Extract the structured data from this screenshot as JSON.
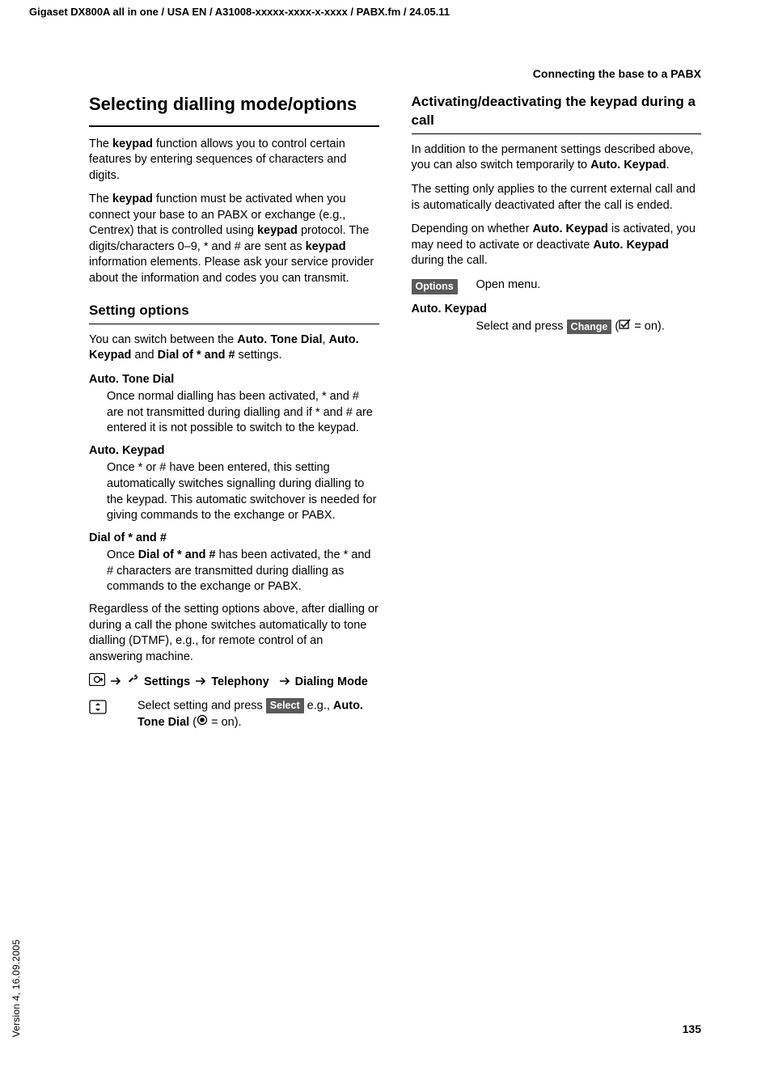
{
  "meta": {
    "header": "Gigaset DX800A all in one / USA EN / A31008-xxxxx-xxxx-x-xxxx / PABX.fm / 24.05.11",
    "section_header": "Connecting the base to a PABX",
    "page_number": "135",
    "version_side": "Version 4, 16.09.2005"
  },
  "left": {
    "h1": "Selecting dialling mode/options",
    "p1_a": "The ",
    "p1_b": "keypad",
    "p1_c": " function allows you to control certain features by entering sequences of characters and digits.",
    "p2_a": "The ",
    "p2_b": "keypad",
    "p2_c": " function must be activated when you connect your base to an PABX or exchange (e.g., Centrex) that is controlled using ",
    "p2_d": "keypad",
    "p2_e": " protocol. The digits/characters 0–9, * and # are sent as ",
    "p2_f": "keypad",
    "p2_g": " information elements. Please ask your service provider about the information and codes you can transmit.",
    "h2": "Setting options",
    "so_p1_a": "You can switch between the ",
    "so_p1_b": "Auto. Tone Dial",
    "so_p1_c": ", ",
    "so_p1_d": "Auto. Keypad",
    "so_p1_e": " and ",
    "so_p1_f": "Dial of * and #",
    "so_p1_g": " settings.",
    "term1": "Auto. Tone Dial",
    "def1": "Once normal dialling has been activated, * and # are not transmitted during dialling and if * and # are entered it is not possible to switch to the keypad.",
    "term2": "Auto. Keypad",
    "def2": "Once * or # have been entered, this setting automatically switches signalling during dialling to the keypad. This automatic switchover is needed for giving commands to the exchange or PABX.",
    "term3": "Dial of * and #",
    "def3_a": "Once ",
    "def3_b": "Dial of * and #",
    "def3_c": " has been activated, the * and # characters are transmitted during dialling as commands to the exchange or PABX.",
    "so_p2": "Regardless of the setting options above, after dialling or during a call the phone switches automatically to tone dialling (DTMF), e.g., for remote control of an answering machine.",
    "nav_settings": "Settings",
    "nav_telephony": "Telephony",
    "nav_dialing": "Dialing Mode",
    "instr1_a": "Select setting and press ",
    "instr1_key": "Select",
    "instr1_b": " e.g., ",
    "instr1_c": "Auto. Tone Dial",
    "instr1_d": " (",
    "instr1_e": " = on)."
  },
  "right": {
    "h2": "Activating/deactivating the keypad during a call",
    "p1_a": "In addition to the permanent settings described above, you can also switch temporarily to ",
    "p1_b": "Auto. Keypad",
    "p1_c": ".",
    "p2": "The setting only applies to the current external call and is automatically deactivated after the call is ended.",
    "p3_a": "Depending on whether ",
    "p3_b": "Auto. Keypad",
    "p3_c": " is activated, you may need to activate or deactivate ",
    "p3_d": "Auto. Keypad",
    "p3_e": " during the call.",
    "row1_key": "Options",
    "row1_text": "Open menu.",
    "term": "Auto. Keypad",
    "row2_a": "Select and press ",
    "row2_key": "Change",
    "row2_b": " (",
    "row2_c": " = on)."
  }
}
